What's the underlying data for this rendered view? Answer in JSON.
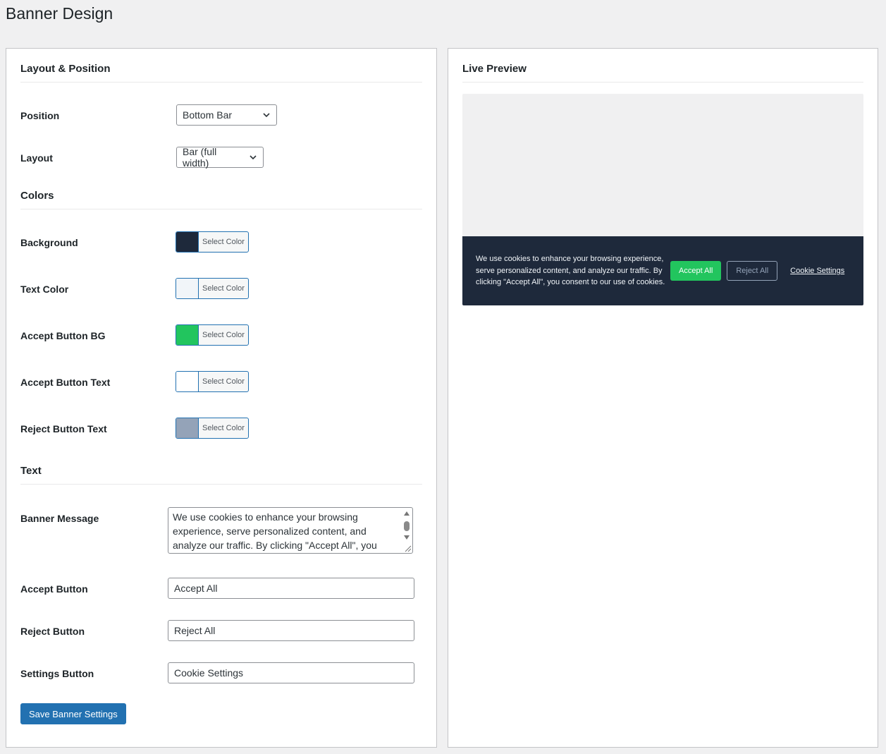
{
  "page": {
    "title": "Banner Design"
  },
  "layout_section": {
    "heading": "Layout & Position",
    "position": {
      "label": "Position",
      "value": "Bottom Bar"
    },
    "layout": {
      "label": "Layout",
      "value": "Bar (full width)"
    }
  },
  "colors_section": {
    "heading": "Colors",
    "items": [
      {
        "label": "Background",
        "button": "Select Color",
        "color": "#1e293b"
      },
      {
        "label": "Text Color",
        "button": "Select Color",
        "color": "#f1f5f9"
      },
      {
        "label": "Accept Button BG",
        "button": "Select Color",
        "color": "#22c55e"
      },
      {
        "label": "Accept Button Text",
        "button": "Select Color",
        "color": "#ffffff"
      },
      {
        "label": "Reject Button Text",
        "button": "Select Color",
        "color": "#94a3b8"
      }
    ]
  },
  "text_section": {
    "heading": "Text",
    "banner_message": {
      "label": "Banner Message",
      "value": "We use cookies to enhance your browsing experience, serve personalized content, and analyze our traffic. By clicking \"Accept All\", you consent to"
    },
    "accept_button": {
      "label": "Accept Button",
      "value": "Accept All"
    },
    "reject_button": {
      "label": "Reject Button",
      "value": "Reject All"
    },
    "settings_button": {
      "label": "Settings Button",
      "value": "Cookie Settings"
    }
  },
  "save_button": {
    "label": "Save Banner Settings"
  },
  "preview": {
    "heading": "Live Preview",
    "banner": {
      "message": "We use cookies to enhance your browsing experience, serve personalized content, and analyze our traffic. By clicking \"Accept All\", you consent to our use of cookies.",
      "accept": "Accept All",
      "reject": "Reject All",
      "settings": "Cookie Settings"
    }
  },
  "icons": {
    "select_arrow": "chevron-down-icon",
    "textarea_scroll": "scrollbar",
    "textarea_resize": "resize-handle-icon"
  }
}
